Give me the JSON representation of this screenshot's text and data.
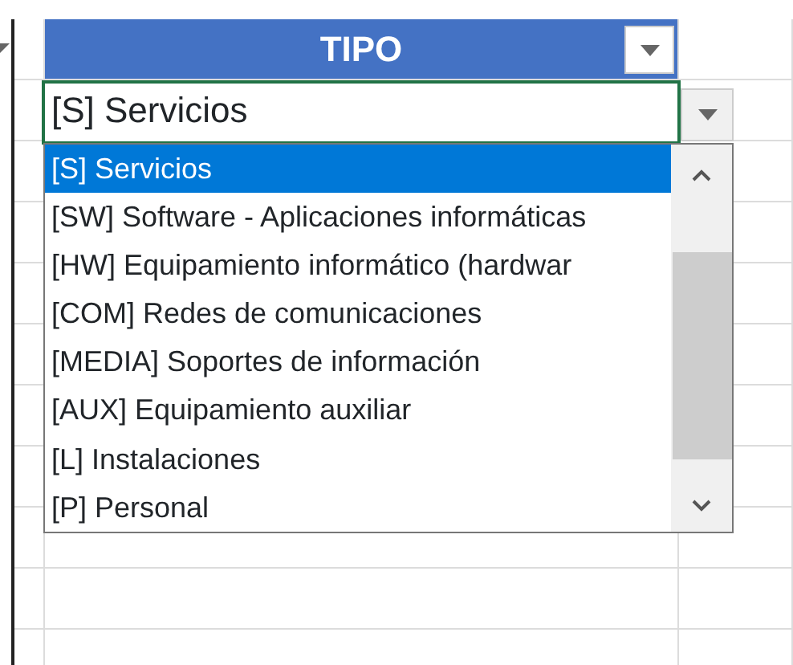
{
  "header": {
    "title": "TIPO"
  },
  "cell": {
    "value": "[S] Servicios"
  },
  "list": {
    "items": [
      {
        "label": "[S] Servicios",
        "selected": true
      },
      {
        "label": "[SW] Software - Aplicaciones informáticas",
        "selected": false
      },
      {
        "label": "[HW] Equipamiento informático (hardwar",
        "selected": false
      },
      {
        "label": "[COM] Redes de comunicaciones",
        "selected": false
      },
      {
        "label": "[MEDIA] Soportes de información",
        "selected": false
      },
      {
        "label": "[AUX] Equipamiento auxiliar",
        "selected": false
      },
      {
        "label": "[L] Instalaciones",
        "selected": false
      },
      {
        "label": "[P] Personal",
        "selected": false
      }
    ]
  }
}
